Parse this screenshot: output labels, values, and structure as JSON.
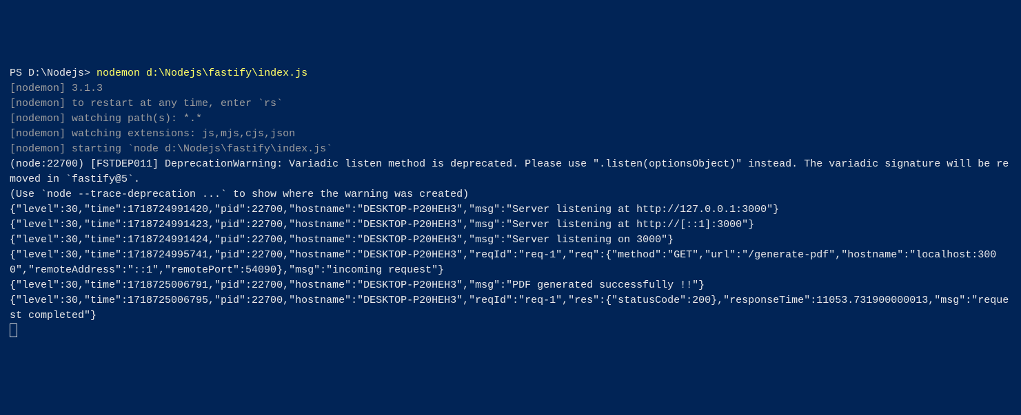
{
  "prompt": {
    "ps": "PS D:\\Nodejs> ",
    "command": "nodemon d:\\Nodejs\\fastify\\index.js"
  },
  "nodemon": {
    "l1": "[nodemon] 3.1.3",
    "l2": "[nodemon] to restart at any time, enter `rs`",
    "l3": "[nodemon] watching path(s): *.*",
    "l4": "[nodemon] watching extensions: js,mjs,cjs,json",
    "l5": "[nodemon] starting `node d:\\Nodejs\\fastify\\index.js`"
  },
  "out": {
    "dep": "(node:22700) [FSTDEP011] DeprecationWarning: Variadic listen method is deprecated. Please use \".listen(optionsObject)\" instead. The variadic signature will be removed in `fastify@5`.",
    "hint": "(Use `node --trace-deprecation ...` to show where the warning was created)",
    "l1": "{\"level\":30,\"time\":1718724991420,\"pid\":22700,\"hostname\":\"DESKTOP-P20HEH3\",\"msg\":\"Server listening at http://127.0.0.1:3000\"}",
    "l2": "{\"level\":30,\"time\":1718724991423,\"pid\":22700,\"hostname\":\"DESKTOP-P20HEH3\",\"msg\":\"Server listening at http://[::1]:3000\"}",
    "l3": "{\"level\":30,\"time\":1718724991424,\"pid\":22700,\"hostname\":\"DESKTOP-P20HEH3\",\"msg\":\"Server listening on 3000\"}",
    "l4": "{\"level\":30,\"time\":1718724995741,\"pid\":22700,\"hostname\":\"DESKTOP-P20HEH3\",\"reqId\":\"req-1\",\"req\":{\"method\":\"GET\",\"url\":\"/generate-pdf\",\"hostname\":\"localhost:3000\",\"remoteAddress\":\"::1\",\"remotePort\":54090},\"msg\":\"incoming request\"}",
    "l5": "{\"level\":30,\"time\":1718725006791,\"pid\":22700,\"hostname\":\"DESKTOP-P20HEH3\",\"msg\":\"PDF generated successfully !!\"}",
    "l6": "{\"level\":30,\"time\":1718725006795,\"pid\":22700,\"hostname\":\"DESKTOP-P20HEH3\",\"reqId\":\"req-1\",\"res\":{\"statusCode\":200},\"responseTime\":11053.731900000013,\"msg\":\"request completed\"}"
  }
}
